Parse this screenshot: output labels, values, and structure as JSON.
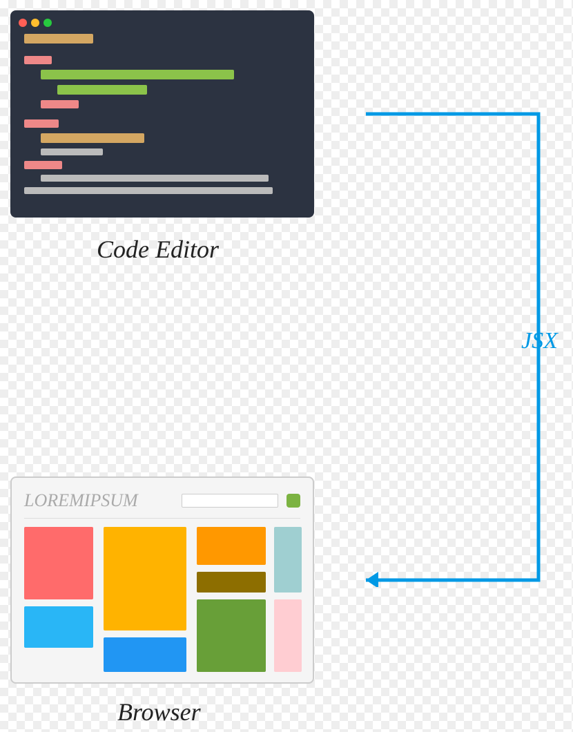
{
  "labels": {
    "code_editor": "Code Editor",
    "browser": "Browser",
    "jsx": "JSX"
  },
  "browser": {
    "title": "LOREMIPSUM"
  },
  "colors": {
    "arrow": "#0099e5",
    "editor_bg": "#2c3341",
    "browser_bg": "#f5f5f5"
  },
  "code_lines": [
    {
      "color": "orange",
      "indent": 1
    },
    {
      "color": "pink",
      "indent": 1
    },
    {
      "color": "green",
      "indent": 2
    },
    {
      "color": "green",
      "indent": 3
    },
    {
      "color": "pink",
      "indent": 2
    },
    {
      "color": "pink",
      "indent": 1
    },
    {
      "color": "orange",
      "indent": 2
    },
    {
      "color": "gray",
      "indent": 2
    },
    {
      "color": "pink",
      "indent": 1
    },
    {
      "color": "gray",
      "indent": 2
    },
    {
      "color": "gray",
      "indent": 1
    }
  ],
  "tiles": [
    {
      "color": "#ff6b6b",
      "name": "red"
    },
    {
      "color": "#ffb300",
      "name": "yellow"
    },
    {
      "color": "#ff9800",
      "name": "orange"
    },
    {
      "color": "#8d6e00",
      "name": "brown"
    },
    {
      "color": "#9fcfd1",
      "name": "teal"
    },
    {
      "color": "#29b6f6",
      "name": "cyan"
    },
    {
      "color": "#2196f3",
      "name": "blue"
    },
    {
      "color": "#689f38",
      "name": "green"
    },
    {
      "color": "#ffcdd2",
      "name": "pink"
    }
  ]
}
